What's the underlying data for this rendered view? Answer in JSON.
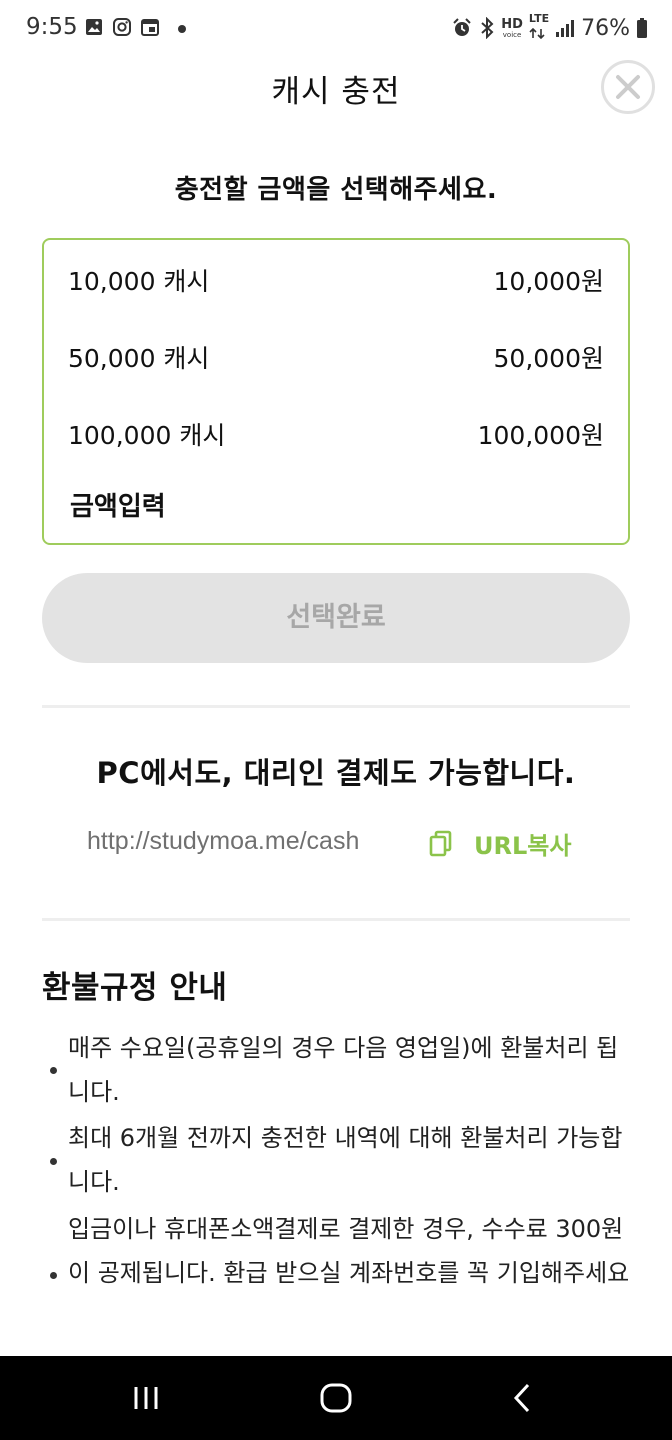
{
  "status_bar": {
    "time": "9:55",
    "battery": "76%",
    "hd_label": "HD",
    "voice_label": "voice",
    "lte_label": "LTE"
  },
  "header": {
    "title": "캐시 충전"
  },
  "subtitle": "충전할 금액을 선택해주세요.",
  "options": [
    {
      "label": "10,000 캐시",
      "price": "10,000원"
    },
    {
      "label": "50,000 캐시",
      "price": "50,000원"
    },
    {
      "label": "100,000 캐시",
      "price": "100,000원"
    }
  ],
  "custom_amount_label": "금액입력",
  "confirm_label": "선택완료",
  "pc_section": {
    "title": "PC에서도, 대리인 결제도 가능합니다.",
    "url": "http://studymoa.me/cash",
    "copy_label": "URL복사"
  },
  "refund": {
    "title": "환불규정 안내",
    "items": [
      "매주 수요일(공휴일의 경우 다음 영업일)에 환불처리 됩니다.",
      "최대 6개월 전까지 충전한 내역에 대해 환불처리 가능합니다.",
      "입금이나 휴대폰소액결제로 결제한 경우, 수수료 300원이 공제됩니다. 환급 받으실 계좌번호를 꼭 기입해주세요"
    ]
  },
  "colors": {
    "accent": "#8bc34a",
    "border": "#9fcc5c",
    "disabled_bg": "#e3e3e3",
    "disabled_text": "#a7a7a7"
  }
}
